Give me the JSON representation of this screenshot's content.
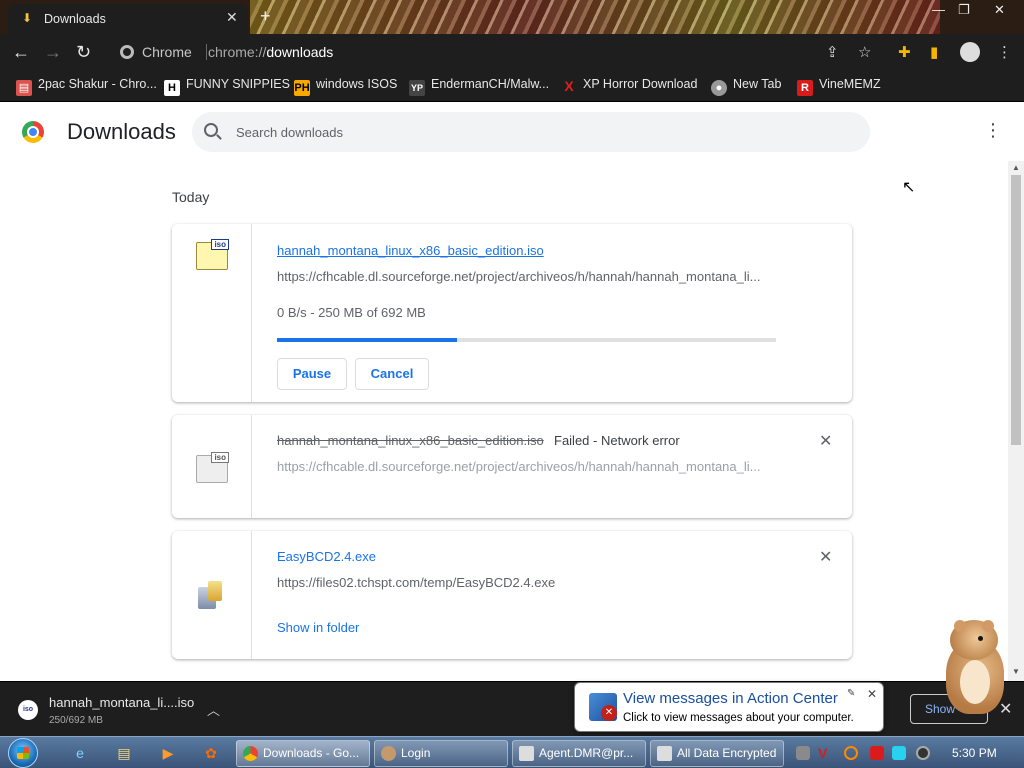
{
  "tab": {
    "title": "Downloads"
  },
  "toolbar": {
    "omnibox_label": "Chrome",
    "url_scheme": "chrome://",
    "url_path": "downloads"
  },
  "bookmarks": [
    {
      "label": "2pac Shakur - Chro...",
      "icon": "folder-icon",
      "color": "#d9534f"
    },
    {
      "label": "FUNNY SNIPPIES",
      "icon": "h-logo-icon",
      "color": "#ffffff"
    },
    {
      "label": "windows ISOS",
      "icon": "ph-logo-icon",
      "color": "#f7a900"
    },
    {
      "label": "EndermanCH/Malw...",
      "icon": "yp-logo-icon",
      "color": "#444444"
    },
    {
      "label": "XP Horror Download",
      "icon": "x-icon",
      "color": "#e02020"
    },
    {
      "label": "New Tab",
      "icon": "globe-icon",
      "color": "#999999"
    },
    {
      "label": "VineMEMZ",
      "icon": "r-logo-icon",
      "color": "#d81b1b"
    }
  ],
  "page": {
    "title": "Downloads",
    "search_placeholder": "Search downloads",
    "day_label": "Today"
  },
  "downloads": [
    {
      "filename": "hannah_montana_linux_x86_basic_edition.iso",
      "url": "https://cfhcable.dl.sourceforge.net/project/archiveos/h/hannah/hannah_montana_li...",
      "status": "0 B/s - 250 MB of 692 MB",
      "progress": 0.36,
      "pause_label": "Pause",
      "cancel_label": "Cancel",
      "icon_tag": "iso"
    },
    {
      "filename": "hannah_montana_linux_x86_basic_edition.iso",
      "url": "https://cfhcable.dl.sourceforge.net/project/archiveos/h/hannah/hannah_montana_li...",
      "failed_text": "Failed - Network error",
      "icon_tag": "iso"
    },
    {
      "filename": "EasyBCD2.4.exe",
      "url": "https://files02.tchspt.com/temp/EasyBCD2.4.exe",
      "link_label": "Show in folder"
    }
  ],
  "shelf": {
    "item_name": "hannah_montana_li....iso",
    "item_size": "250/692 MB",
    "icon_tag": "iso",
    "show_all_label": "Show"
  },
  "notification": {
    "title": "View messages in Action Center",
    "text": "Click to view messages about your computer."
  },
  "taskbar": {
    "tasks": [
      {
        "label": "Downloads - Go...",
        "icon_color": "#f4b400"
      },
      {
        "label": "Login",
        "icon_color": "#c49a6c"
      },
      {
        "label": "Agent.DMR@pr...",
        "icon_color": "#dddddd"
      },
      {
        "label": "All Data Encrypted",
        "icon_color": "#dddddd"
      }
    ],
    "clock": "5:30 PM"
  }
}
